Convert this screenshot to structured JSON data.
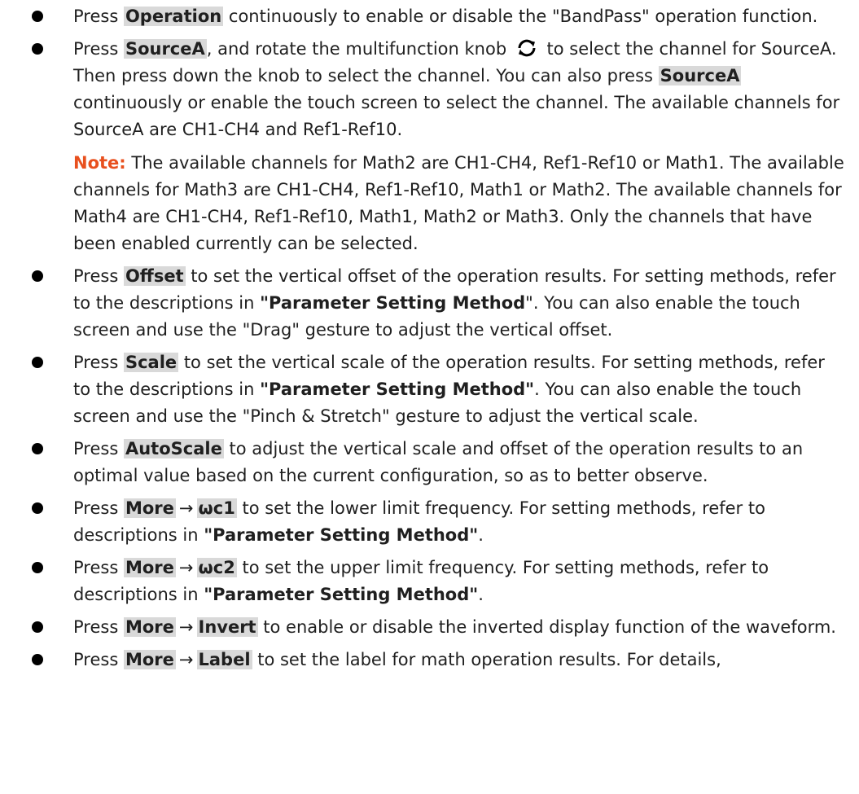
{
  "items": [
    {
      "parts": [
        {
          "t": "Press "
        },
        {
          "b": "Operation"
        },
        {
          "t": " continuously to enable or disable the \"BandPass\" operation function."
        }
      ]
    },
    {
      "parts": [
        {
          "t": "Press "
        },
        {
          "b": "SourceA"
        },
        {
          "t": ", and rotate the multifunction knob "
        },
        {
          "icon": "rotate-knob-icon"
        },
        {
          "t": " to select the channel for SourceA. Then press down the knob to select the channel. You can also press "
        },
        {
          "b": "SourceA"
        },
        {
          "t": " continuously or enable the touch screen to select the channel. The available channels for SourceA are CH1-CH4 and Ref1-Ref10."
        }
      ],
      "note": {
        "label": "Note:",
        "text": " The available channels for Math2 are CH1-CH4, Ref1-Ref10 or Math1. The available channels for Math3 are CH1-CH4, Ref1-Ref10, Math1 or Math2. The available channels for Math4 are CH1-CH4, Ref1-Ref10, Math1, Math2 or Math3. Only the channels that have been enabled currently can be selected."
      }
    },
    {
      "parts": [
        {
          "t": "Press "
        },
        {
          "b": "Offset"
        },
        {
          "t": " to set the vertical offset of the operation results. For setting methods, refer to the descriptions in "
        },
        {
          "r": "\"Parameter Setting Method"
        },
        {
          "t": "\". You can also enable the touch screen and use the \"Drag\" gesture to adjust the vertical offset."
        }
      ]
    },
    {
      "parts": [
        {
          "t": "Press "
        },
        {
          "b": "Scale"
        },
        {
          "t": " to set the vertical scale of the operation results. For setting methods, refer to the descriptions in "
        },
        {
          "r": "\"Parameter Setting Method\""
        },
        {
          "t": ". You can also enable the touch screen and use the \"Pinch & Stretch\" gesture to adjust the vertical scale."
        }
      ]
    },
    {
      "parts": [
        {
          "t": "Press "
        },
        {
          "b": "AutoScale"
        },
        {
          "t": " to adjust the vertical scale and offset of the operation results to an optimal value based on the current configuration, so as to better observe."
        }
      ]
    },
    {
      "parts": [
        {
          "t": "Press "
        },
        {
          "b": "More"
        },
        {
          "a": "→"
        },
        {
          "b": "ωc1"
        },
        {
          "t": " to set the lower limit frequency. For setting methods, refer to descriptions in "
        },
        {
          "r": "\"Parameter Setting Method\""
        },
        {
          "t": "."
        }
      ]
    },
    {
      "parts": [
        {
          "t": "Press "
        },
        {
          "b": "More"
        },
        {
          "a": "→"
        },
        {
          "b": "ωc2"
        },
        {
          "t": " to set the upper limit frequency. For setting methods, refer to descriptions in "
        },
        {
          "r": "\"Parameter Setting Method\""
        },
        {
          "t": "."
        }
      ]
    },
    {
      "parts": [
        {
          "t": "Press "
        },
        {
          "b": "More"
        },
        {
          "a": "→"
        },
        {
          "b": "Invert"
        },
        {
          "t": " to enable or disable the inverted display function of the waveform."
        }
      ]
    },
    {
      "parts": [
        {
          "t": "Press "
        },
        {
          "b": "More"
        },
        {
          "a": "→"
        },
        {
          "b": "Label"
        },
        {
          "t": " to set the label for math operation results. For details,"
        }
      ]
    }
  ]
}
